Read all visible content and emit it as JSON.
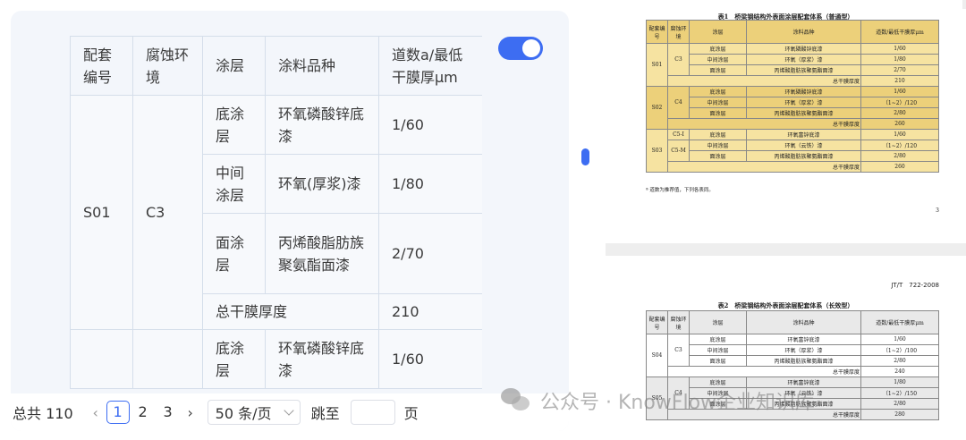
{
  "table": {
    "headers": [
      "配套编号",
      "腐蚀环境",
      "涂层",
      "涂料品种",
      "道数a/最低干膜厚μm"
    ],
    "rows": [
      {
        "code": "S01",
        "env": "C3",
        "coats": [
          {
            "layer": "底涂层",
            "product": "环氧磷酸锌底漆",
            "spec": "1/60"
          },
          {
            "layer": "中间涂层",
            "product": "环氧(厚浆)漆",
            "spec": "1/80"
          },
          {
            "layer": "面涂层",
            "product": "丙烯酸脂肪族聚氨酯面漆",
            "spec": "2/70"
          }
        ],
        "total_label": "总干膜厚度",
        "total": "210"
      },
      {
        "code": "",
        "env": "",
        "coats": [
          {
            "layer": "底涂层",
            "product": "环氧磷酸锌底漆",
            "spec": "1/60"
          }
        ]
      }
    ]
  },
  "pagination": {
    "total": "总共 110",
    "pages": [
      "1",
      "2",
      "3"
    ],
    "current": "1",
    "page_size": "50 条/页",
    "jump_label": "跳至",
    "page_label": "页"
  },
  "doc1": {
    "title": "表1　桥梁钢结构外表面涂层配套体系（普通型）",
    "headers": [
      "配套编号",
      "腐蚀环境",
      "涂层",
      "涂料品种",
      "道数/最低干膜厚μm"
    ],
    "groups": [
      {
        "code": "S01",
        "env": "C3",
        "rows": [
          [
            "底涂层",
            "环氧磷酸锌底漆",
            "1/60"
          ],
          [
            "中间涂层",
            "环氧（厚浆）漆",
            "1/80"
          ],
          [
            "面涂层",
            "丙烯酸脂肪族聚氨酯面漆",
            "2/70"
          ]
        ],
        "total": "210"
      },
      {
        "code": "S02",
        "env": "C4",
        "rows": [
          [
            "底涂层",
            "环氧磷酸锌底漆",
            "1/60"
          ],
          [
            "中间涂层",
            "环氧（厚浆）漆",
            "（1~2）/120"
          ],
          [
            "面涂层",
            "丙烯酸脂肪族聚氨酯面漆",
            "2/80"
          ]
        ],
        "total": "260"
      },
      {
        "code": "S03",
        "env": "C5-I",
        "env2": "C5-M",
        "rows": [
          [
            "底涂层",
            "环氧富锌底漆",
            "1/60"
          ],
          [
            "中间涂层",
            "环氧（云铁）漆",
            "（1~2）/120"
          ],
          [
            "面涂层",
            "丙烯酸脂肪族聚氨酯面漆",
            "2/80"
          ]
        ],
        "total": "260"
      }
    ],
    "total_label": "总干膜厚度",
    "note": "ª 道数为推荐值，下列各表同。",
    "page_no": "3"
  },
  "doc2": {
    "code": "JT/T　722-2008",
    "title": "表2　桥梁钢结构外表面涂层配套体系（长效型）",
    "headers": [
      "配套编号",
      "腐蚀环境",
      "涂层",
      "涂料品种",
      "道数/最低干膜厚μm"
    ],
    "groups": [
      {
        "code": "S04",
        "env": "C3",
        "rows": [
          [
            "底涂层",
            "环氧富锌底漆",
            "1/60"
          ],
          [
            "中间涂层",
            "环氧（厚浆）漆",
            "（1~2）/100"
          ],
          [
            "面涂层",
            "丙烯酸脂肪族聚氨酯面漆",
            "2/80"
          ]
        ],
        "total": "240"
      },
      {
        "code": "S05",
        "env": "C4",
        "rows": [
          [
            "底涂层",
            "环氧富锌底漆",
            "1/80"
          ],
          [
            "中间涂层",
            "环氧（云铁）漆",
            "（1~2）/150"
          ],
          [
            "面涂层",
            "丙烯酸脂肪族聚氨酯面漆",
            "2/80"
          ]
        ],
        "total": "280"
      }
    ],
    "total_label": "总干膜厚度"
  },
  "watermark": "公众号 · KnowFlow企业知识库",
  "colors": {
    "accent": "#3d6df2",
    "doc1_fill": "#f6e3a1"
  }
}
